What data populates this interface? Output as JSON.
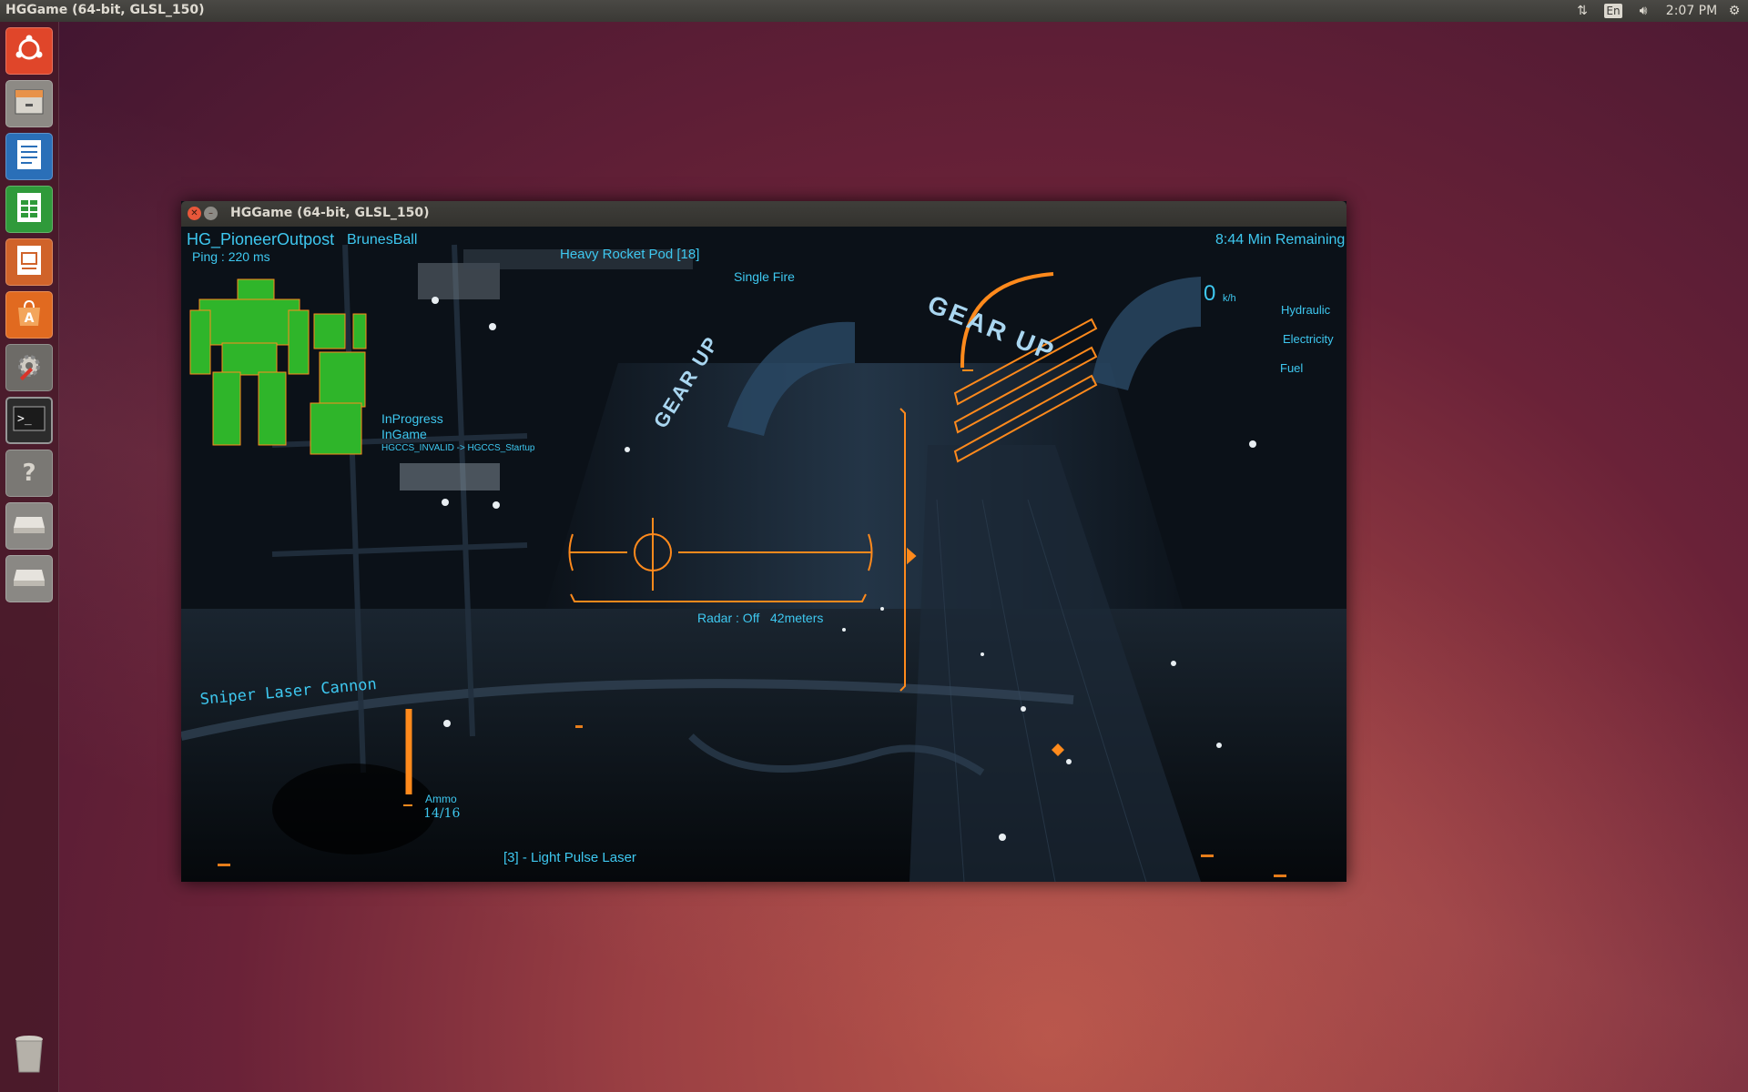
{
  "top_panel": {
    "app_title": "HGGame (64-bit, GLSL_150)",
    "network_icon": "network-updown-icon",
    "keyboard_layout": "En",
    "volume_icon": "speaker-icon",
    "clock": "2:07 PM",
    "session_icon": "gear-icon"
  },
  "launcher": {
    "items": [
      {
        "name": "ubuntu-dash",
        "icon": "ubuntu-logo-icon",
        "color": "#e0462a"
      },
      {
        "name": "files",
        "icon": "file-cabinet-icon",
        "color": "#8d8a85"
      },
      {
        "name": "writer",
        "icon": "document-icon",
        "color": "#2a6fb8"
      },
      {
        "name": "calc",
        "icon": "spreadsheet-icon",
        "color": "#2f9a3a"
      },
      {
        "name": "impress",
        "icon": "presentation-icon",
        "color": "#d0632a"
      },
      {
        "name": "software-center",
        "icon": "shopping-bag-icon",
        "color": "#e16a20"
      },
      {
        "name": "system-settings",
        "icon": "wrench-gear-icon",
        "color": "#6d6b67"
      },
      {
        "name": "terminal",
        "icon": "terminal-icon",
        "color": "#3a3a3a"
      },
      {
        "name": "unknown-app",
        "icon": "question-icon",
        "color": "#7a7874"
      },
      {
        "name": "drive-1",
        "icon": "drive-icon",
        "color": "#8a8884"
      },
      {
        "name": "drive-2",
        "icon": "drive-icon",
        "color": "#8a8884"
      }
    ],
    "trash_icon": "trash-icon"
  },
  "window": {
    "title": "HGGame (64-bit, GLSL_150)"
  },
  "hud": {
    "map_name": "HG_PioneerOutpost",
    "player_name": "BrunesBall",
    "ping": "Ping : 220 ms",
    "timer": "8:44 Min Remaining",
    "weapon_top": "Heavy Rocket Pod [18]",
    "fire_mode": "Single Fire",
    "speed_value": "0",
    "speed_unit": "k/h",
    "gauges": [
      "Hydraulic",
      "Electricity",
      "Fuel"
    ],
    "status_lines": [
      "InProgress",
      "InGame",
      "HGCCS_INVALID -> HGCCS_Startup"
    ],
    "radar": "Radar : Off",
    "distance": "42meters",
    "weapon_selected": "Sniper Laser Cannon",
    "ammo_label": "Ammo",
    "ammo_count": "14/16",
    "weapon_slot": "[3] - Light Pulse Laser",
    "signs": [
      "GEAR UP",
      "GEAR UP"
    ],
    "colors": {
      "cyan": "#3ec8f0",
      "orange": "#ff8a1c",
      "mech_green": "#2fb52a"
    }
  }
}
